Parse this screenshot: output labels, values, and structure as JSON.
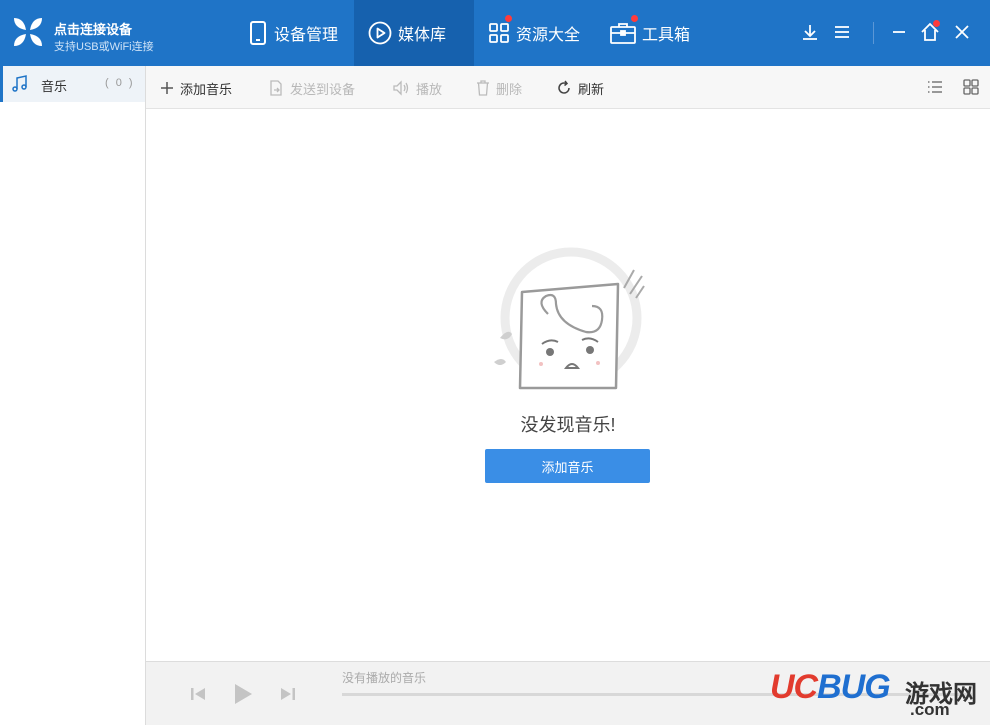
{
  "brand": {
    "title": "点击连接设备",
    "subtitle": "支持USB或WiFi连接"
  },
  "nav": {
    "device_mgmt": "设备管理",
    "media_library": "媒体库",
    "resources": "资源大全",
    "toolbox": "工具箱"
  },
  "sidebar": {
    "items": [
      {
        "label": "音乐",
        "count": "( 0 )"
      }
    ]
  },
  "toolbar": {
    "add_music": "添加音乐",
    "send_to_device": "发送到设备",
    "play": "播放",
    "delete": "删除",
    "refresh": "刷新"
  },
  "empty_state": {
    "message": "没发现音乐!",
    "button": "添加音乐"
  },
  "player": {
    "now_playing": "没有播放的音乐"
  },
  "watermark": {
    "uc": "UC",
    "bug": "BUG",
    "cn": "游戏网",
    "com": ".com"
  },
  "colors": {
    "accent": "#1f74c7",
    "accent_dark": "#1661ae",
    "button": "#3a8ee6",
    "badge": "#ff3b3b"
  }
}
